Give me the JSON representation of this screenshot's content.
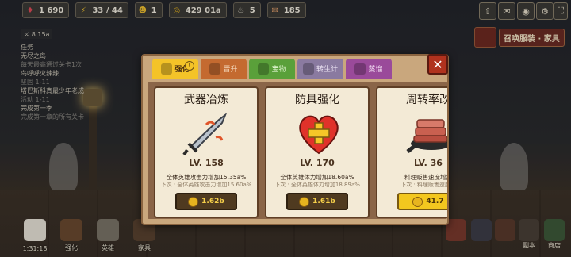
{
  "topbar": {
    "resources": [
      {
        "icon": "gem-icon",
        "value": "1 690",
        "color": "#e14c5a"
      },
      {
        "icon": "energy-icon",
        "value": "33 / 44",
        "color": "#f2c230"
      },
      {
        "icon": "hero-icon",
        "value": "1",
        "color": "#f2c230"
      },
      {
        "icon": "coin-icon",
        "value": "429 01a",
        "color": "#e7b41f"
      },
      {
        "icon": "chef-icon",
        "value": "5",
        "color": "#d9d4c6"
      },
      {
        "icon": "ticket-icon",
        "value": "185",
        "color": "#d99a6a"
      }
    ],
    "right_icons": [
      "upload-icon",
      "camera-icon",
      "settings-icon",
      "fullscreen-icon"
    ]
  },
  "left_panel": {
    "score": "8.15a",
    "lines": [
      "任务",
      "无尽之岛",
      "每天最高通过关卡1次",
      "岛呼呼火辣辣",
      "坚固 1-11",
      "塔巴斯科真最少年老成",
      "活动 1-11",
      "完成第一季",
      "完成第一章的所有关卡"
    ]
  },
  "summon": {
    "label": "召唤服装 · 家具"
  },
  "modal": {
    "tabs": [
      {
        "label": "强化",
        "icon": "strengthen-icon",
        "active": true,
        "color": "#f4c328"
      },
      {
        "label": "晋升",
        "icon": "promote-icon",
        "active": false,
        "color": "#c46a30"
      },
      {
        "label": "宝物",
        "icon": "treasure-icon",
        "active": false,
        "color": "#5aa03a"
      },
      {
        "label": "转生计",
        "icon": "rebirth-icon",
        "active": false,
        "color": "#8a7aa0"
      },
      {
        "label": "蒸馏",
        "icon": "distill-icon",
        "active": false,
        "color": "#9a4a9a"
      }
    ],
    "cards": [
      {
        "title": "武器冶炼",
        "art": "sword-icon",
        "level": "LV. 158",
        "desc": "全体英雄攻击力增加15.35a%",
        "next": "下次 : 全体英雄攻击力增加15.60a%",
        "cost": "1.62b",
        "cost_style": "dark"
      },
      {
        "title": "防具强化",
        "art": "heart-shield-icon",
        "level": "LV. 170",
        "desc": "全体英雄体力增加18.60a%",
        "next": "下次 : 全体英雄体力增加18.89a%",
        "cost": "1.61b",
        "cost_style": "dark"
      },
      {
        "title": "周转率改",
        "art": "meat-pan-icon",
        "level": "LV. 36",
        "desc": "料理贩售速度增加",
        "next": "下次 : 料理贩售速度增",
        "cost": "41.7",
        "cost_style": "bright"
      }
    ]
  },
  "bottombar": {
    "items": [
      {
        "label": "",
        "icon": "chef-hat-icon"
      },
      {
        "label": "强化",
        "icon": "anvil-icon"
      },
      {
        "label": "英雄",
        "icon": "hero-icon"
      },
      {
        "label": "家具",
        "icon": "furniture-icon"
      }
    ],
    "timer": "1:31:18",
    "right_items": [
      {
        "label": "",
        "icon": "meat-icon"
      },
      {
        "label": "",
        "icon": "potion-icon"
      },
      {
        "label": "",
        "icon": "fork-icon"
      },
      {
        "label": "副本",
        "icon": "dungeon-icon"
      },
      {
        "label": "商店",
        "icon": "shop-icon"
      }
    ]
  }
}
